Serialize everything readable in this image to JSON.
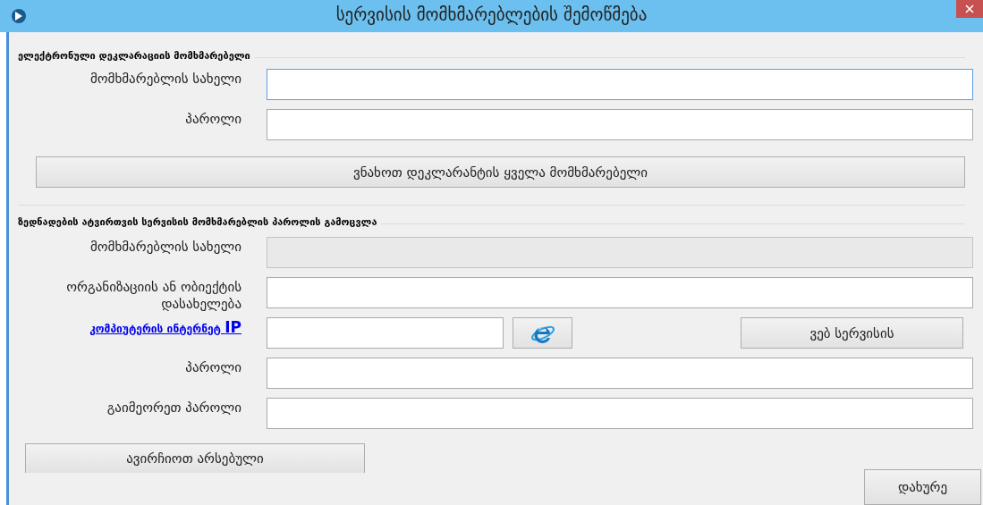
{
  "window": {
    "title": "სერვისის მომხმარებლების შემოწმება"
  },
  "sections": [
    {
      "title": "ელექტრონული დეკლარაციის მომხმარებელი",
      "rows": [
        {
          "kind": "field",
          "label": "მომხმარებლის სახელი",
          "focused": true,
          "disabled": false
        },
        {
          "kind": "field",
          "label": "პაროლი",
          "focused": false,
          "disabled": false
        },
        {
          "kind": "button",
          "label": "ვნახოთ დეკლარანტის ყველა მომხმარებელი"
        }
      ]
    },
    {
      "title": "ზედნადების ატვირთვის სერვისის მომხმარებლის პაროლის გამოცვლა",
      "rows": [
        {
          "kind": "field",
          "label": "მომხმარებლის სახელი",
          "focused": false,
          "disabled": true
        },
        {
          "kind": "field",
          "label": "ორგანიზაციის ან ობიექტის დასახელება",
          "focused": false,
          "disabled": false
        },
        {
          "kind": "ip",
          "link": "კომპიუტერის ინტერნეტ **IP**",
          "action": "ვებ სერვისის"
        },
        {
          "kind": "field",
          "label": "პაროლი",
          "focused": false,
          "disabled": false
        },
        {
          "kind": "field",
          "label": "გაიმეორეთ პაროლი",
          "focused": false,
          "disabled": false
        }
      ]
    }
  ],
  "select_button": "ავირჩიოთ არსებული",
  "close_button": "დახურე"
}
